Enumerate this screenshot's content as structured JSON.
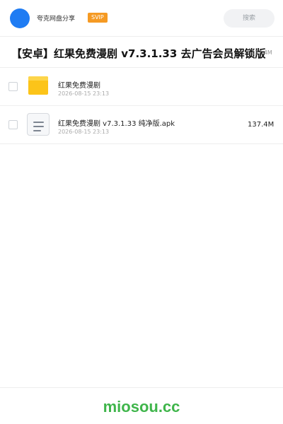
{
  "header": {
    "username": "夸克网盘分享",
    "badge": "SVIP",
    "search_label": "搜索",
    "avatar_color": "#1f7cf3",
    "badge_color": "#f59a23"
  },
  "share": {
    "title": "【安卓】红果免费漫剧 v7.3.1.33 去广告会员解锁版",
    "total_size": "137.4M"
  },
  "files": [
    {
      "name": "红果免费漫剧",
      "date": "2026-08-15 23:13",
      "size": "",
      "icon": "folder-icon"
    },
    {
      "name": "红果免费漫剧 v7.3.1.33 纯净版.apk",
      "date": "2026-08-15 23:13",
      "size": "137.4M",
      "icon": "document-icon"
    }
  ],
  "footer": {
    "brand": "miosou.cc",
    "brand_color": "#3fb54b"
  }
}
